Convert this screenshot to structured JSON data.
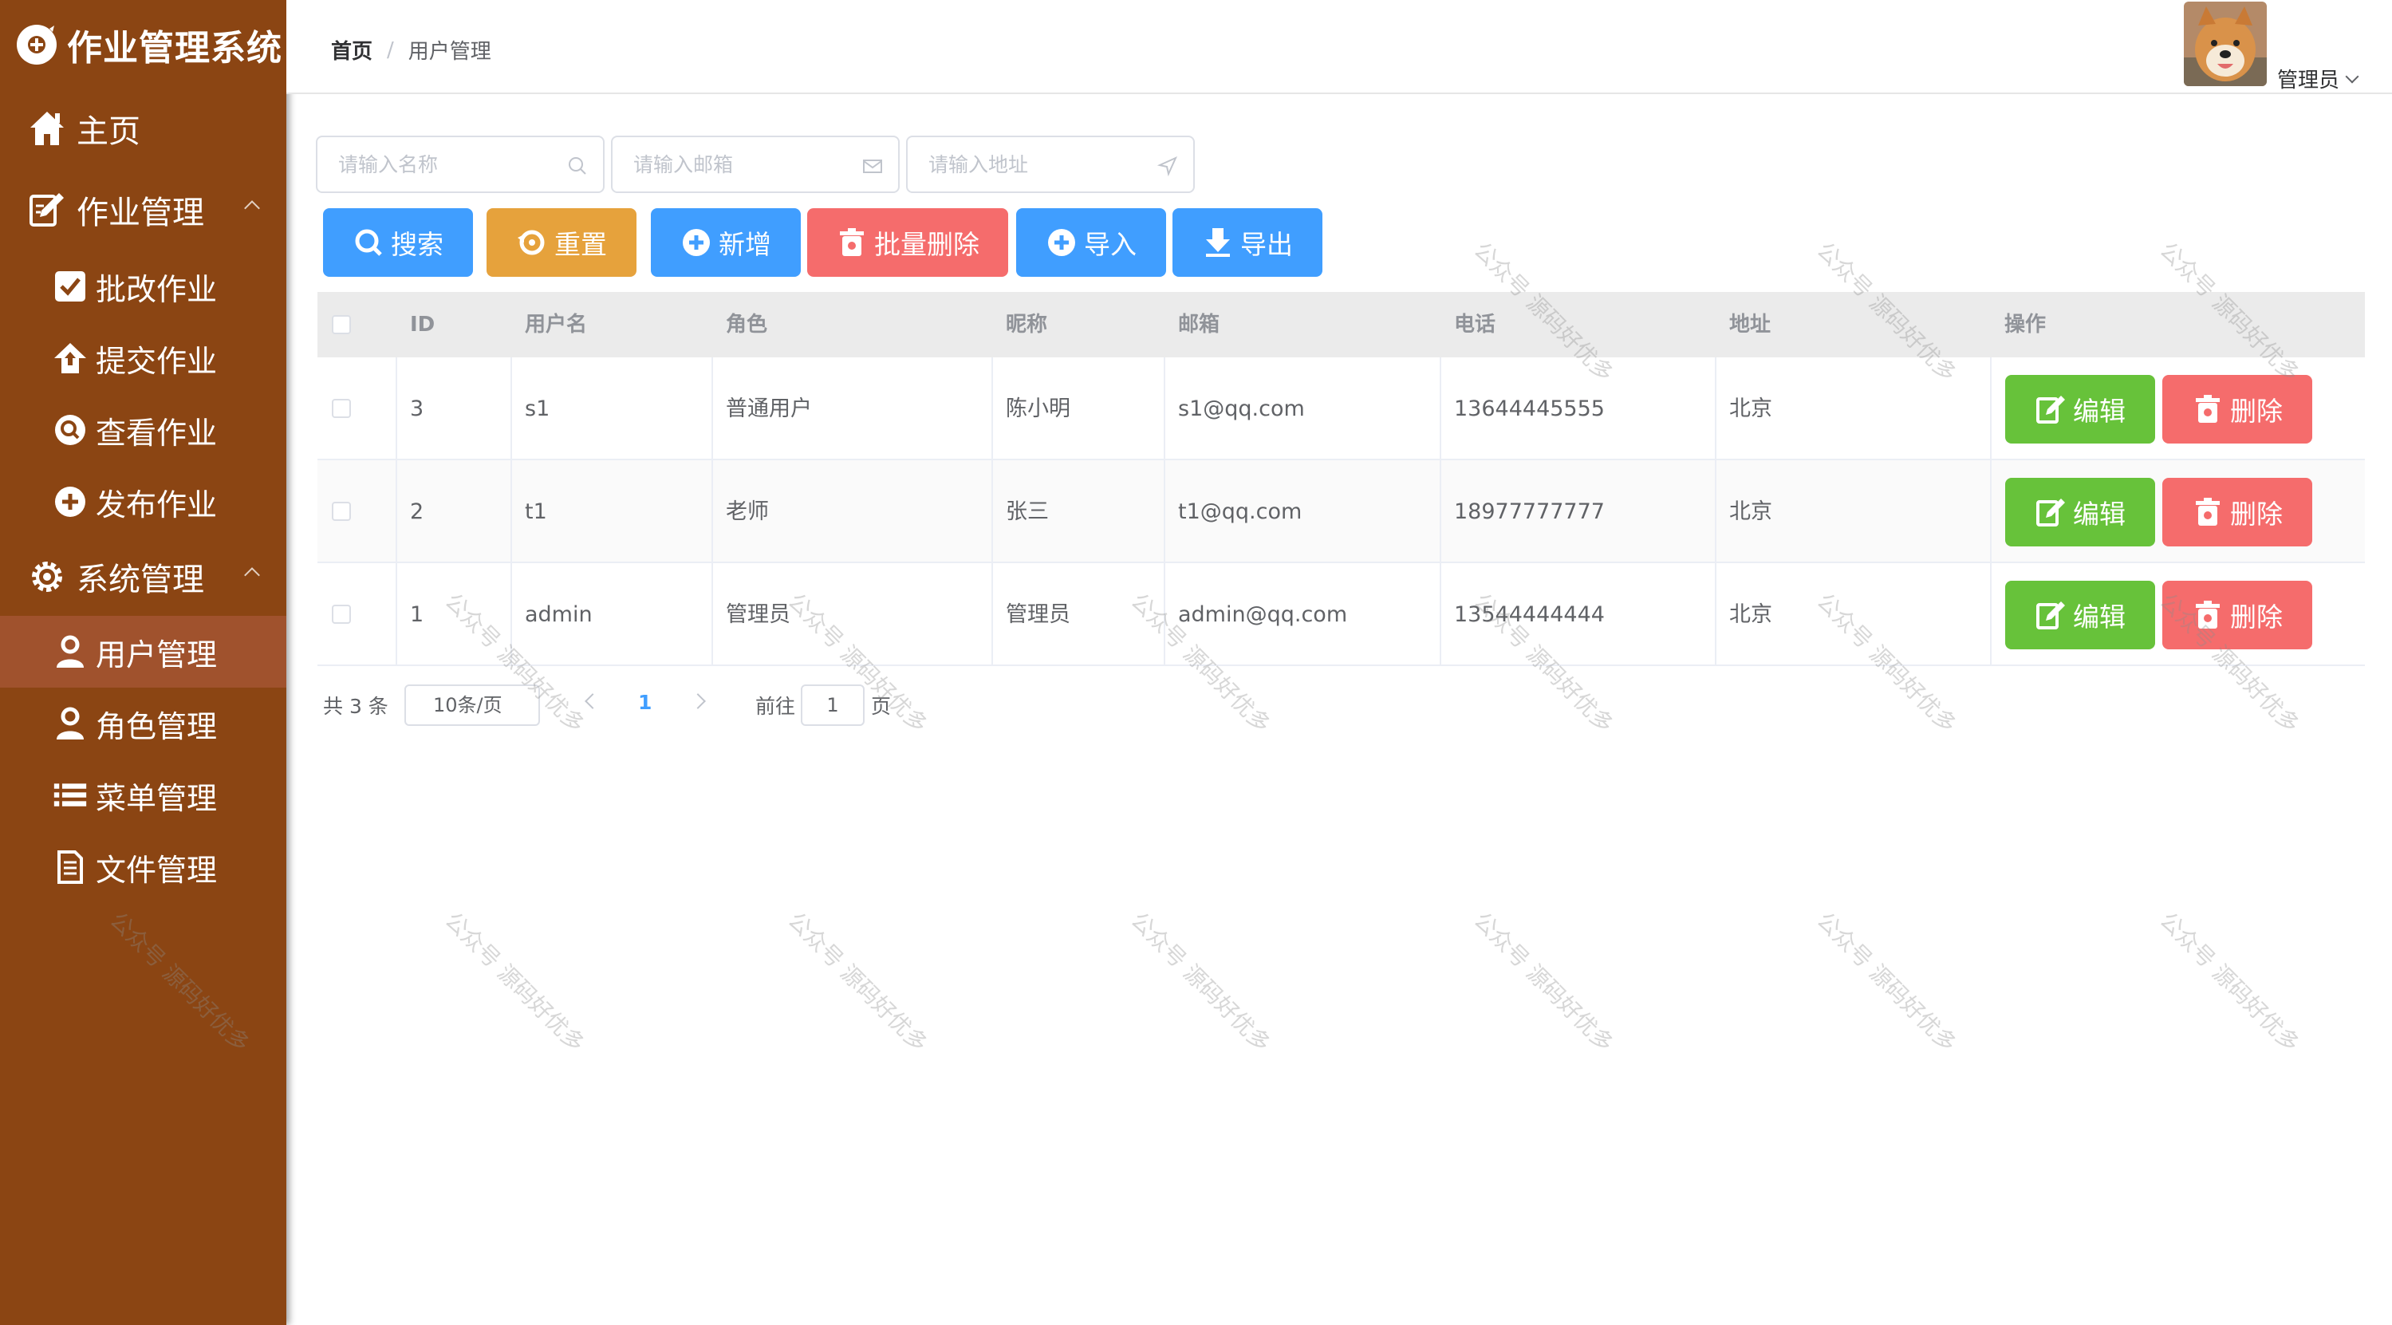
{
  "app": {
    "title": "作业管理系统"
  },
  "sidebar": {
    "items": [
      {
        "label": "主页"
      },
      {
        "label": "作业管理"
      },
      {
        "label": "批改作业"
      },
      {
        "label": "提交作业"
      },
      {
        "label": "查看作业"
      },
      {
        "label": "发布作业"
      },
      {
        "label": "系统管理"
      },
      {
        "label": "用户管理"
      },
      {
        "label": "角色管理"
      },
      {
        "label": "菜单管理"
      },
      {
        "label": "文件管理"
      }
    ]
  },
  "header": {
    "breadcrumb": {
      "home": "首页",
      "separator": "/",
      "current": "用户管理"
    },
    "user": {
      "name": "管理员"
    }
  },
  "search": {
    "name_placeholder": "请输入名称",
    "email_placeholder": "请输入邮箱",
    "address_placeholder": "请输入地址"
  },
  "toolbar": {
    "search": "搜索",
    "reset": "重置",
    "add": "新增",
    "batch_delete": "批量删除",
    "import": "导入",
    "export": "导出"
  },
  "table": {
    "columns": [
      "ID",
      "用户名",
      "角色",
      "昵称",
      "邮箱",
      "电话",
      "地址",
      "操作"
    ],
    "rows": [
      {
        "id": "3",
        "username": "s1",
        "role": "普通用户",
        "nickname": "陈小明",
        "email": "s1@qq.com",
        "phone": "13644445555",
        "address": "北京"
      },
      {
        "id": "2",
        "username": "t1",
        "role": "老师",
        "nickname": "张三",
        "email": "t1@qq.com",
        "phone": "18977777777",
        "address": "北京"
      },
      {
        "id": "1",
        "username": "admin",
        "role": "管理员",
        "nickname": "管理员",
        "email": "admin@qq.com",
        "phone": "13544444444",
        "address": "北京"
      }
    ],
    "actions": {
      "edit": "编辑",
      "delete": "删除"
    }
  },
  "pagination": {
    "total": "共 3 条",
    "page_size": "10条/页",
    "current_page": "1",
    "goto_label": "前往",
    "goto_value": "1",
    "goto_unit": "页"
  },
  "watermark": {
    "text": "公众号 源码好优多"
  },
  "colors": {
    "sidebar": "#8b4513",
    "sidebar_active": "#a0522d",
    "primary": "#409eff",
    "warning": "#e6a23c",
    "danger": "#f56c6c",
    "success": "#67c23a"
  }
}
